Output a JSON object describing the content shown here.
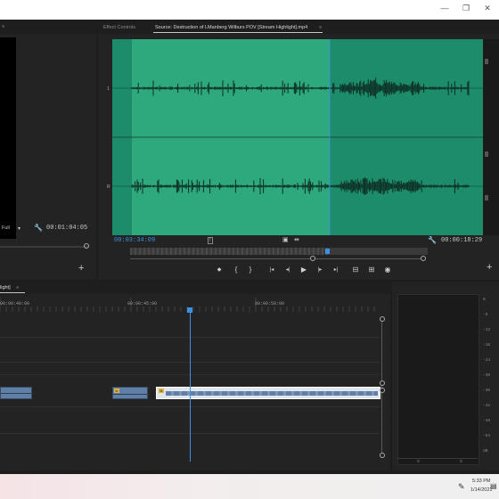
{
  "window": {
    "minimize_glyph": "—",
    "restore_glyph": "❐",
    "close_glyph": "✕"
  },
  "program_monitor": {
    "menu_glyph": "≡",
    "fit_label": "Full",
    "timecode": "00:01:04:05",
    "add_glyph": "+"
  },
  "source_monitor": {
    "tabs": [
      {
        "label": "Effect Controls"
      },
      {
        "label": "Source: Destruction of LManberg Wilburs POV [Stream Highlight].mp4"
      }
    ],
    "tab_menu_glyph": "≡",
    "channel_labels": [
      "1",
      "R"
    ],
    "db_labels": [
      "-∞",
      "-∞"
    ],
    "current_timecode": "00:03:34:09",
    "duration_timecode": "00:00:18:29",
    "add_glyph": "+",
    "accent_color": "#2ea97e",
    "playhead_color": "#3d8fe0",
    "transport": {
      "marker": "◆",
      "in": "{",
      "out": "}",
      "go_in": "|◂",
      "step_back": "◂|",
      "play": "▶",
      "step_forward": "|▸",
      "go_out": "▸|",
      "insert": "⊟",
      "overwrite": "⊞",
      "export_frame": "◉"
    }
  },
  "timeline": {
    "tab_label": "light]",
    "tab_menu_glyph": "≡",
    "ruler_labels": [
      "00:00:40:00",
      "00:00:45:00",
      "00:00:50:00"
    ],
    "clip_badge": "fx"
  },
  "audio_meter": {
    "scale": [
      "0",
      "-6",
      "-12",
      "-18",
      "-24",
      "-30",
      "-36",
      "-42",
      "-48",
      "-54",
      "dB"
    ],
    "channels": [
      "S",
      "S"
    ]
  },
  "taskbar": {
    "time": "5:33 PM",
    "date": "1/14/2021",
    "pen_icon_glyph": "✎",
    "notification_glyph": "▤"
  }
}
